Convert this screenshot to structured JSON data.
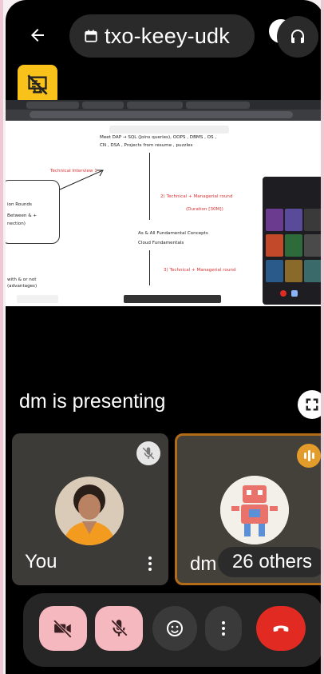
{
  "header": {
    "meeting_code": "txo-keey-udk",
    "back_icon": "arrow-left-icon",
    "calendar_icon": "calendar-icon",
    "audio_icon": "headphones-icon"
  },
  "badges": {
    "no_audio_icon": "muted-presentation-icon",
    "badge_color": "#f9c21b"
  },
  "presentation": {
    "presenter_text": "dm is presenting",
    "fullscreen_icon": "fullscreen-icon",
    "whiteboard_notes": [
      "Meet DAP → SQL (Joins queries), OOPS , DBMS , OS ,",
      "CN , DSA , Projects from resume , puzzles",
      "Technical Interview 1",
      "2) Technical + Managerial round",
      "(Duration [30M])",
      "As & All Fundamental Concepts",
      "Cloud Fundamentals",
      "3) Technical + Managerial round",
      "ion Rounds",
      "Between & +",
      "nection)",
      "with & or not",
      "(advantages)"
    ]
  },
  "participants": [
    {
      "name": "You",
      "status_icon": "mic-off-icon",
      "more_icon": "more-vert-icon"
    },
    {
      "name": "dm",
      "status_icon": "speaking-icon",
      "more_icon": "more-vert-icon"
    }
  ],
  "others_label": "26 others",
  "controls": {
    "camera_icon": "camera-off-icon",
    "mic_icon": "mic-off-icon",
    "emoji_icon": "emoji-icon",
    "more_icon": "more-vert-icon",
    "end_icon": "end-call-icon",
    "accent_colors": {
      "muted_bg": "#f6b8bf",
      "end_call": "#e02a22",
      "speaking": "#e39b2a"
    }
  }
}
